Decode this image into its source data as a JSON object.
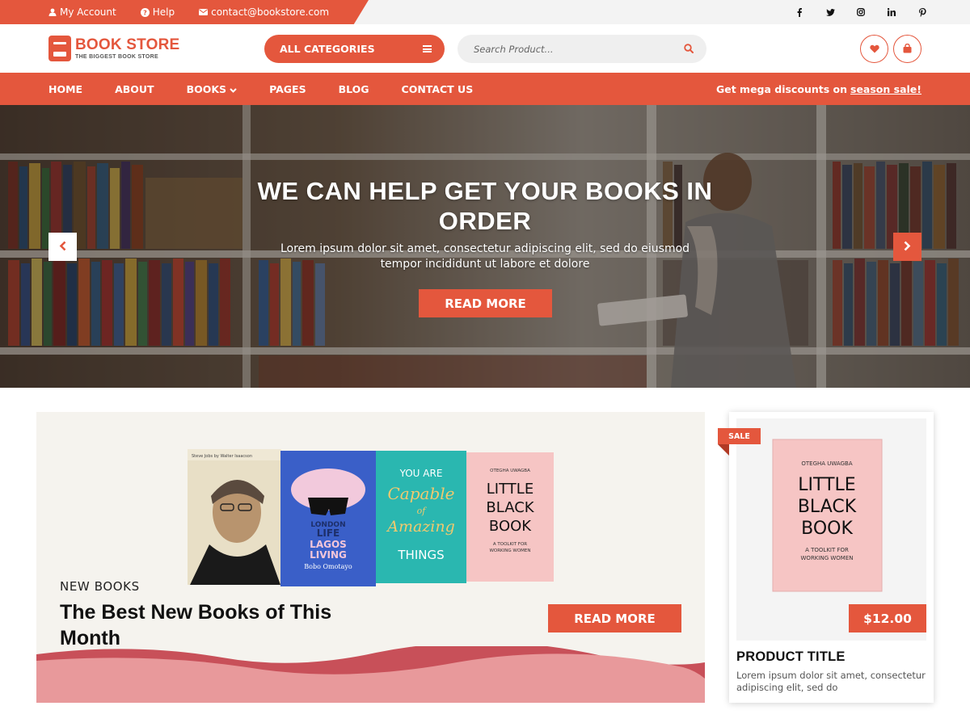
{
  "colors": {
    "accent": "#e4573d",
    "accent_dark": "#b13a25",
    "topbar_bg": "#f3f3f3",
    "banner_bg": "#f5f3ee",
    "wave_pink": "#e8999b",
    "wave_red": "#c85059"
  },
  "topbar": {
    "account_label": "My Account",
    "help_label": "Help",
    "email": "contact@bookstore.com",
    "social": [
      "facebook-icon",
      "twitter-icon",
      "instagram-icon",
      "linkedin-icon",
      "pinterest-icon"
    ]
  },
  "header": {
    "logo_title": "BOOK STORE",
    "logo_subtitle": "THE BIGGEST BOOK STORE",
    "categories_label": "ALL CATEGORIES",
    "search_placeholder": "Search Product..."
  },
  "nav": {
    "items": [
      "HOME",
      "ABOUT",
      "BOOKS",
      "PAGES",
      "BLOG",
      "CONTACT US"
    ],
    "promo_text": "Get mega discounts on",
    "promo_link": "season sale!"
  },
  "hero": {
    "title": "WE CAN HELP GET YOUR BOOKS IN ORDER",
    "text": "Lorem ipsum dolor sit amet, consectetur adipiscing elit, sed do eiusmod tempor incididunt ut labore et dolore",
    "button": "READ MORE"
  },
  "banner": {
    "kicker": "NEW BOOKS",
    "title": "The Best New Books of This Month",
    "button": "READ MORE",
    "books": {
      "book1_author": "Steve Jobs by Walter Isaacson",
      "book2_title_1": "LONDON",
      "book2_title_2": "LIFE",
      "book2_title_3": "LAGOS",
      "book2_title_4": "LIVING",
      "book2_author": "Bobo Omotayo",
      "book3_line1": "YOU ARE",
      "book3_line2": "Capable",
      "book3_line3": "of",
      "book3_line4": "Amazing",
      "book3_line5": "THINGS",
      "book4_author": "OTEGHA UWAGBA",
      "book4_title_1": "LITTLE",
      "book4_title_2": "BLACK",
      "book4_title_3": "BOOK",
      "book4_sub_1": "A TOOLKIT FOR",
      "book4_sub_2": "WORKING WOMEN"
    }
  },
  "product": {
    "sale_label": "SALE",
    "cover_author": "OTEGHA UWAGBA",
    "cover_title_1": "LITTLE",
    "cover_title_2": "BLACK",
    "cover_title_3": "BOOK",
    "cover_sub_1": "A TOOLKIT FOR",
    "cover_sub_2": "WORKING WOMEN",
    "price": "$12.00",
    "title": "PRODUCT TITLE",
    "description": "Lorem ipsum dolor sit amet, consectetur adipiscing elit, sed do"
  }
}
